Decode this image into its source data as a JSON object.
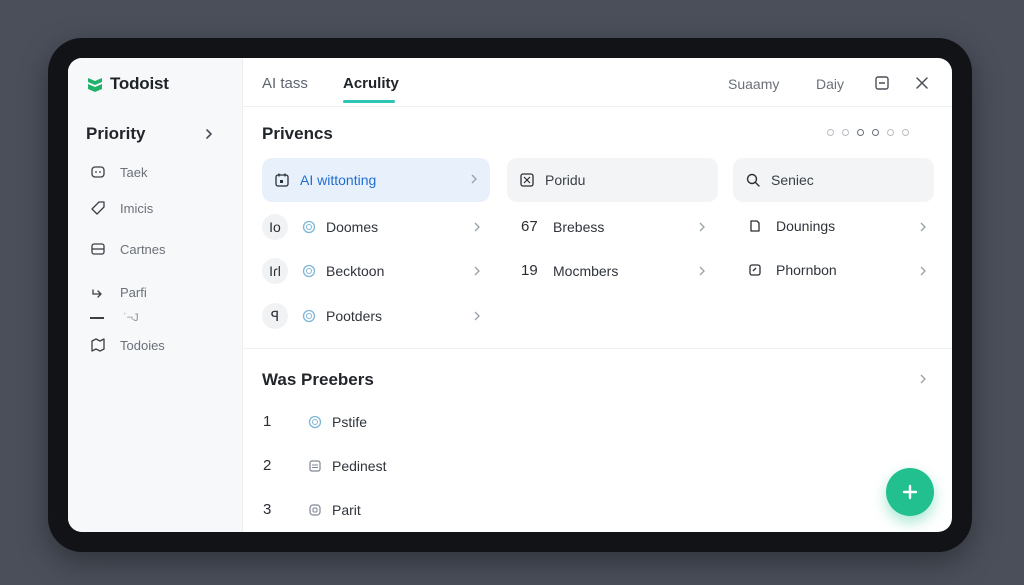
{
  "app": {
    "name": "Todoist"
  },
  "sidebar": {
    "heading": "Priority",
    "items": [
      {
        "label": "Taek",
        "icon": "chat-icon"
      },
      {
        "label": "Imicis",
        "icon": "tag-icon"
      },
      {
        "label": "Cartnes",
        "icon": "card-icon"
      },
      {
        "label": "Parfi",
        "icon": "arrow-icon"
      },
      {
        "label": "Todoies",
        "icon": "map-icon"
      }
    ],
    "small_text": "ˈ¬J"
  },
  "topbar": {
    "tabs": [
      "AI tass",
      "Acrulity"
    ],
    "right_links": [
      "Suaamy",
      "Daiy"
    ]
  },
  "section1": {
    "title": "Privencs",
    "cards": [
      {
        "label": "AI wittonting",
        "icon": "calendar-icon"
      },
      {
        "label": "Poridu",
        "icon": "box-icon"
      },
      {
        "label": "Seniec",
        "icon": "search-icon"
      }
    ],
    "col1": [
      {
        "lead": "Io",
        "label": "Doomes"
      },
      {
        "lead": "Iɾl",
        "label": "Becktoon"
      },
      {
        "lead": "ꟼ",
        "label": "Pootders"
      }
    ],
    "col2": [
      {
        "num": "67",
        "label": "Brebess"
      },
      {
        "num": "19",
        "label": "Mocmbers"
      }
    ],
    "col3": [
      {
        "label": "Dounings",
        "icon": "doc-icon"
      },
      {
        "label": "Phornbon",
        "icon": "check-square-icon"
      }
    ]
  },
  "section2": {
    "title": "Was Preebers",
    "rows": [
      {
        "num": "1",
        "label": "Pstife",
        "icon": "ring-icon"
      },
      {
        "num": "2",
        "label": "Pedinest",
        "icon": "list-icon"
      },
      {
        "num": "3",
        "label": "Parit",
        "icon": "file-icon"
      }
    ]
  },
  "colors": {
    "accent": "#2ec4b6",
    "fab": "#22c08e",
    "active_card": "#e8f1fb",
    "active_text": "#1f6fd0"
  }
}
